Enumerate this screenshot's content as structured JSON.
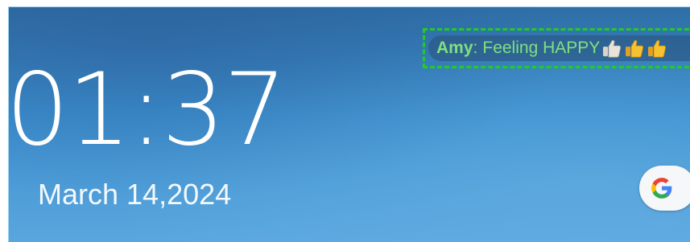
{
  "lock_screen": {
    "time": "01:37",
    "date": "March 14,2024"
  },
  "status": {
    "name": "Amy",
    "separator": ":",
    "message": "Feeling HAPPY",
    "emojis": [
      "thumbs-up-light-icon",
      "thumbs-up-icon",
      "thumbs-up-icon"
    ],
    "name_color": "#7fe07f",
    "highlight_color": "#22cc22"
  },
  "google_button": {
    "icon": "google-g-icon",
    "colors": {
      "blue": "#4285F4",
      "red": "#EA4335",
      "yellow": "#FBBC05",
      "green": "#34A853"
    }
  },
  "wallpaper": {
    "top_color": "#2f6ea6",
    "bottom_color": "#5aa6de"
  }
}
